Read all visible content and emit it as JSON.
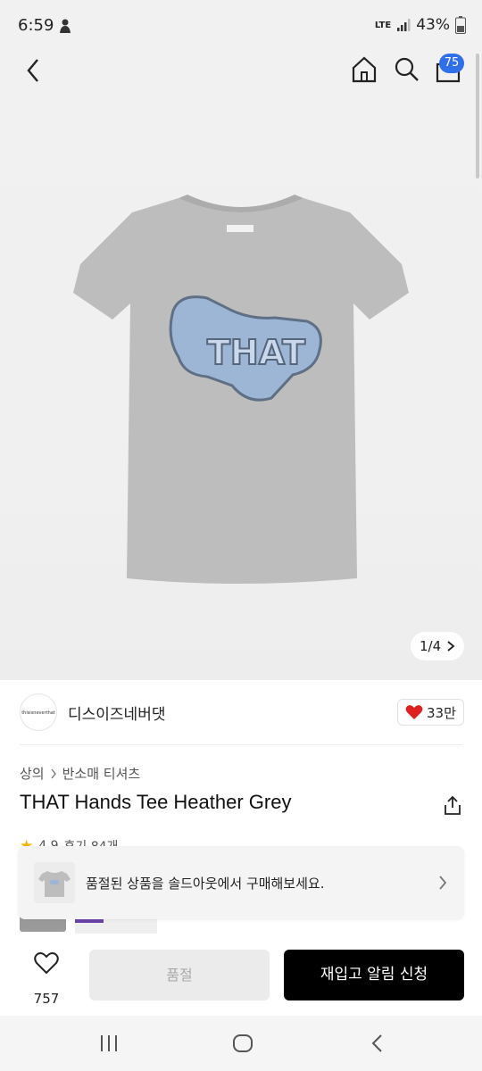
{
  "status_bar": {
    "time": "6:59",
    "network": "LTE",
    "battery": "43%"
  },
  "nav": {
    "cart_count": "75"
  },
  "gallery": {
    "pager": "1/4"
  },
  "brand": {
    "logo_text": "thisisneverthat",
    "name": "디스이즈네버댓",
    "likes": "33만"
  },
  "breadcrumb": {
    "category": "상의",
    "subcategory": "반소매 티셔츠"
  },
  "product": {
    "title": "THAT Hands Tee Heather Grey"
  },
  "rating": {
    "score": "4.9",
    "reviews": "후기 84개"
  },
  "toast": {
    "message": "품절된 상품을 솔드아웃에서 구매해보세요."
  },
  "action_bar": {
    "like_count": "757",
    "soldout_label": "품절",
    "restock_label": "재입고 알림 신청"
  },
  "colors": {
    "badge": "#2f6fe9",
    "heart": "#e02020",
    "primary_button": "#000000",
    "disabled_button": "#ebebeb"
  },
  "icons": [
    "back-icon",
    "home-icon",
    "search-icon",
    "cart-icon",
    "chevron-right-icon",
    "heart-icon",
    "share-icon",
    "recent-apps-icon",
    "home-button-icon",
    "system-back-icon"
  ]
}
